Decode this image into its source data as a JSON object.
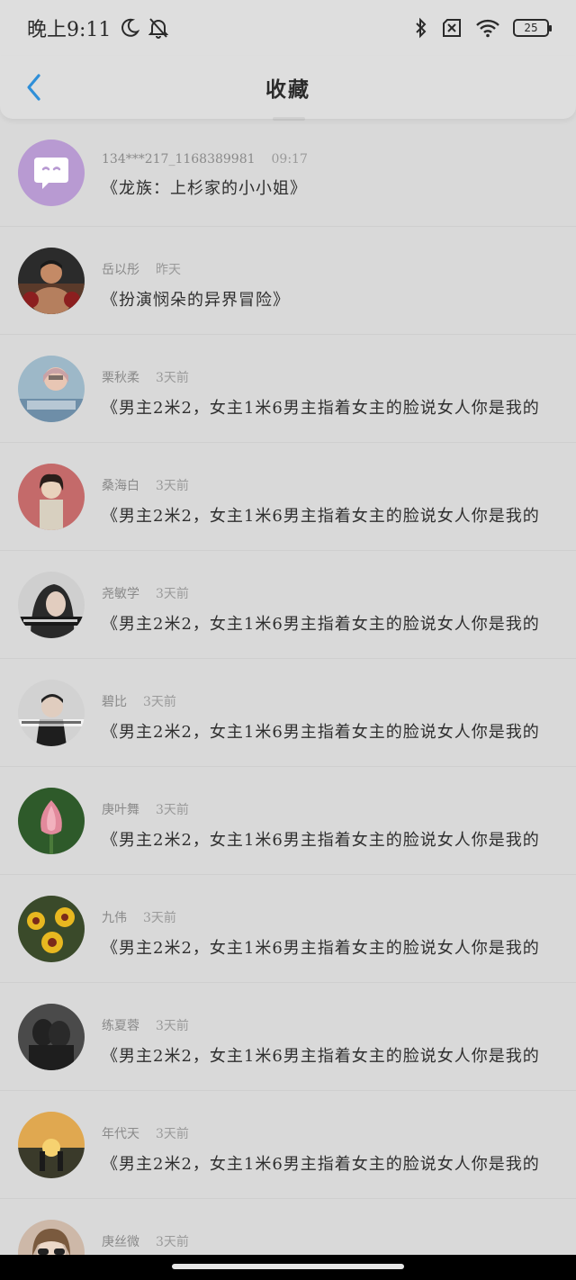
{
  "status_bar": {
    "time": "晚上9:11",
    "battery": "25",
    "icons": [
      "moon-icon",
      "bell-off-icon",
      "bluetooth-icon",
      "sim-off-icon",
      "wifi-icon",
      "battery-icon"
    ]
  },
  "nav": {
    "title": "收藏",
    "back_icon": "chevron-left-icon",
    "accent": "#2f8fd8"
  },
  "items": [
    {
      "name": "134***217_1168389981",
      "time": "09:17",
      "title": "《龙族：上杉家的小小姐》",
      "avatar": "chat-bubble"
    },
    {
      "name": "岳以彤",
      "time": "昨天",
      "title": "《扮演悯朵的异界冒险》",
      "avatar": "boxer"
    },
    {
      "name": "栗秋柔",
      "time": "3天前",
      "title": "《男主2米2，女主1米6男主指着女主的脸说女人你是我的",
      "avatar": "pink-hair"
    },
    {
      "name": "桑海白",
      "time": "3天前",
      "title": "《男主2米2，女主1米6男主指着女主的脸说女人你是我的",
      "avatar": "anime-boy"
    },
    {
      "name": "尧敏学",
      "time": "3天前",
      "title": "《男主2米2，女主1米6男主指着女主的脸说女人你是我的",
      "avatar": "woman-dark"
    },
    {
      "name": "碧比",
      "time": "3天前",
      "title": "《男主2米2，女主1米6男主指着女主的脸说女人你是我的",
      "avatar": "man-text"
    },
    {
      "name": "庚叶舞",
      "time": "3天前",
      "title": "《男主2米2，女主1米6男主指着女主的脸说女人你是我的",
      "avatar": "lotus"
    },
    {
      "name": "九伟",
      "time": "3天前",
      "title": "《男主2米2，女主1米6男主指着女主的脸说女人你是我的",
      "avatar": "yellow-flowers"
    },
    {
      "name": "练夏蓉",
      "time": "3天前",
      "title": "《男主2米2，女主1米6男主指着女主的脸说女人你是我的",
      "avatar": "couple-dark"
    },
    {
      "name": "年代天",
      "time": "3天前",
      "title": "《男主2米2，女主1米6男主指着女主的脸说女人你是我的",
      "avatar": "sunset-couple"
    },
    {
      "name": "庚丝微",
      "time": "3天前",
      "title": "",
      "avatar": "sunglasses-girl"
    }
  ]
}
